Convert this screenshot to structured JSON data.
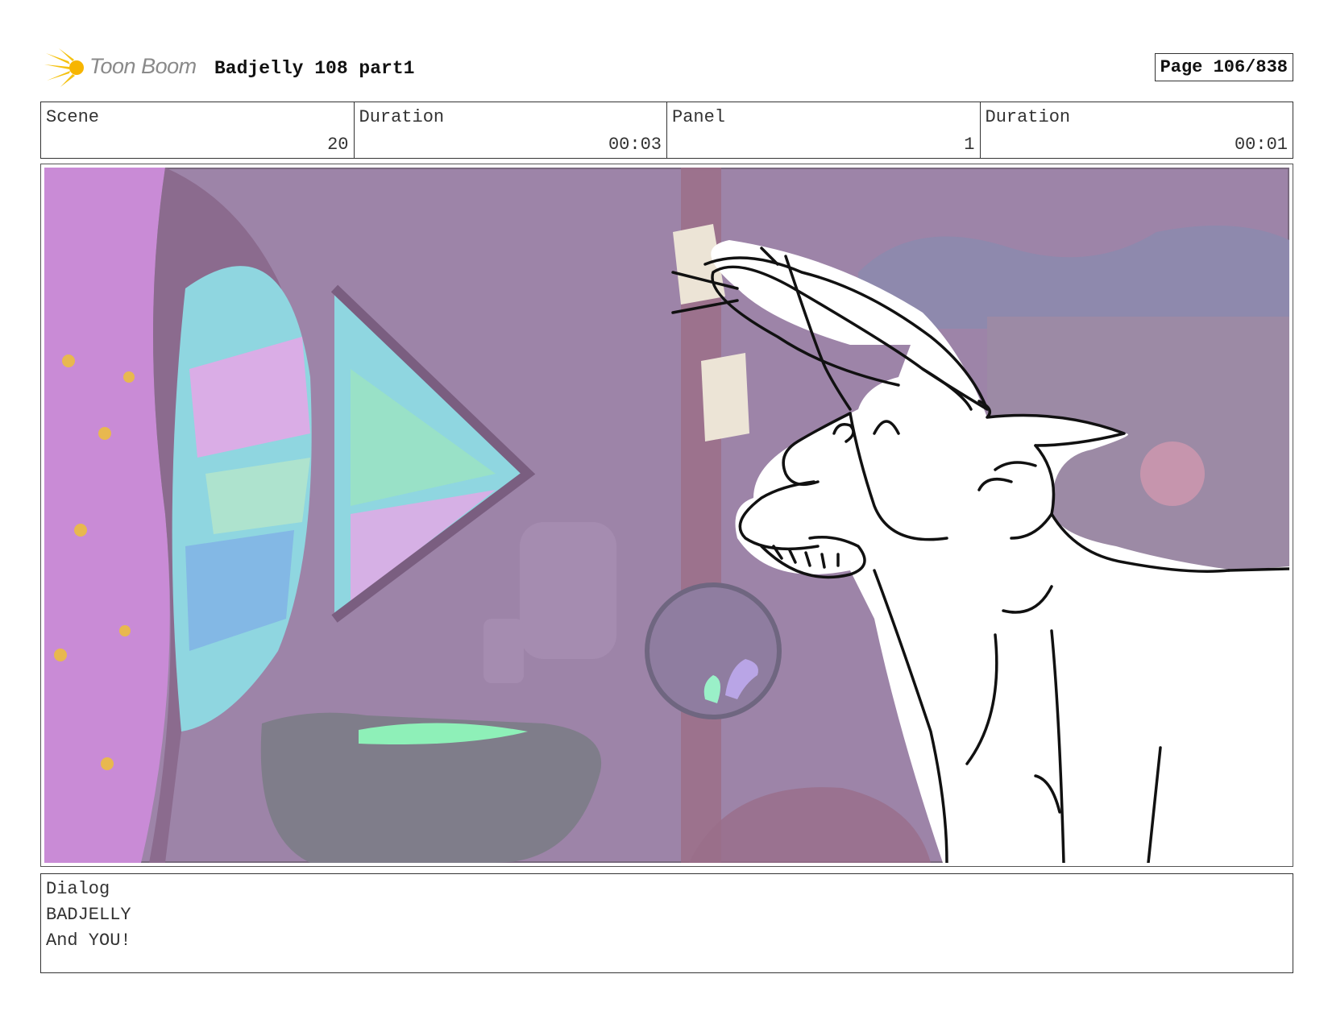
{
  "header": {
    "logo_text": "Toon Boom",
    "logo_icon": "sunburst-logo-icon",
    "title": "Badjelly 108 part1",
    "page": "Page 106/838"
  },
  "info": {
    "scene_label": "Scene",
    "scene_value": "20",
    "scene_duration_label": "Duration",
    "scene_duration_value": "00:03",
    "panel_label": "Panel",
    "panel_value": "1",
    "panel_duration_label": "Duration",
    "panel_duration_value": "00:01"
  },
  "dialog": {
    "label": "Dialog",
    "character": "BADJELLY",
    "line": "And YOU!"
  },
  "colors": {
    "background_purple": "#9a7fa6",
    "stained_glass_cyan": "#8fd6e0",
    "stained_glass_pink": "#e7a6e6",
    "cauldron_green": "#8ef0b8",
    "sketch_ink": "#111111"
  }
}
